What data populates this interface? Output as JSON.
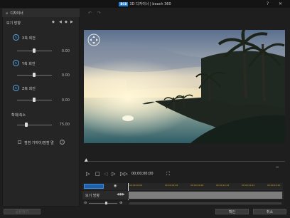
{
  "window": {
    "logo_text": "BCB",
    "title": "3D 디자이너 | beach 360",
    "help": "?",
    "close": "✕"
  },
  "left_panel": {
    "header": "디자이너",
    "section": "보기 방향",
    "x_rotation": {
      "label": "X축 회전",
      "value": "0.00",
      "level": 0.5
    },
    "y_rotation": {
      "label": "Y축 회전",
      "value": "0.00",
      "level": 0.5
    },
    "z_rotation": {
      "label": "Z축 회전",
      "value": "0.00",
      "level": 0.5
    },
    "zoom": {
      "label": "확대/축소",
      "value": "75.00",
      "level": 0.2
    },
    "lock_label": "점점 가까이/점점 멀",
    "help": "?"
  },
  "playback": {
    "timecode": "00;00;00;00"
  },
  "timeline": {
    "track_label": "보기 방향",
    "ticks": [
      "00;00;00;00",
      "00;00;04;28",
      "00;00;09;26",
      "00;00;14;24",
      "00;00;19;22",
      "00;00;24;20",
      "00;00;29;18"
    ]
  },
  "footer": {
    "share": "공유하기",
    "ok": "확인",
    "cancel": "취소"
  },
  "colors": {
    "accent": "#1e7fd6",
    "timeline_ticks": "#d4a017"
  }
}
